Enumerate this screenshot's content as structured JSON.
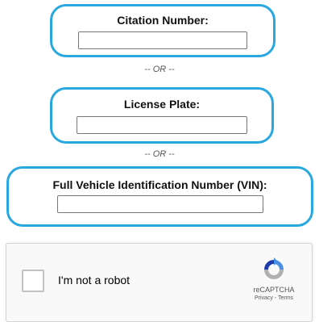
{
  "form": {
    "citation": {
      "label": "Citation Number:",
      "value": ""
    },
    "or1": "-- OR --",
    "plate": {
      "label": "License Plate:",
      "value": ""
    },
    "or2": "-- OR --",
    "vin": {
      "label": "Full Vehicle Identification Number (VIN):",
      "value": ""
    }
  },
  "recaptcha": {
    "checkbox_label": "I'm not a robot",
    "brand": "reCAPTCHA",
    "privacy": "Privacy",
    "separator": " - ",
    "terms": "Terms"
  },
  "colors": {
    "highlight": "#29a8e0",
    "recaptcha_blue": "#4a90e2",
    "recaptcha_gray": "#b0b0b0"
  },
  "icons": {
    "recaptcha_logo": "recaptcha-logo-icon"
  }
}
